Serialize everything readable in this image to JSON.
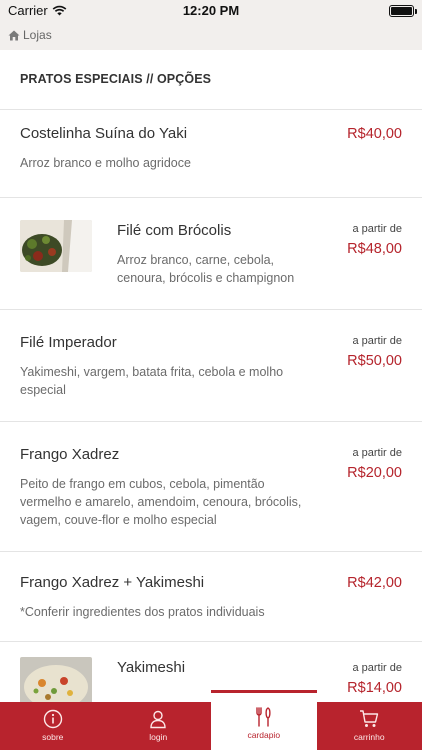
{
  "status_bar": {
    "carrier": "Carrier",
    "time": "12:20 PM",
    "battery_level": 1.0
  },
  "nav": {
    "back_label": "Lojas",
    "back_icon": "home-icon"
  },
  "section": {
    "title": "PRATOS ESPECIAIS // OPÇÕES"
  },
  "items": [
    {
      "name": "Costelinha Suína do Yaki",
      "desc": "Arroz branco e molho agridoce",
      "price_from": "",
      "price": "R$40,00",
      "has_image": false
    },
    {
      "name": "Filé com Brócolis",
      "desc": "Arroz branco, carne, cebola, cenoura, brócolis e champignon",
      "price_from": "a partir de",
      "price": "R$48,00",
      "has_image": true
    },
    {
      "name": "Filé Imperador",
      "desc": "Yakimeshi, vargem, batata frita, cebola e molho especial",
      "price_from": "a partir de",
      "price": "R$50,00",
      "has_image": false
    },
    {
      "name": "Frango Xadrez",
      "desc": "Peito de frango em cubos, cebola, pimentão vermelho e amarelo, amendoim, cenoura, brócolis, vagem, couve-flor e molho especial",
      "price_from": "a partir de",
      "price": "R$20,00",
      "has_image": false
    },
    {
      "name": "Frango Xadrez + Yakimeshi",
      "desc": "*Conferir ingredientes dos pratos individuais",
      "price_from": "",
      "price": "R$42,00",
      "has_image": false
    },
    {
      "name": "Yakimeshi",
      "desc": "",
      "price_from": "a partir de",
      "price": "R$14,00",
      "has_image": true
    }
  ],
  "tabs": [
    {
      "label": "sobre",
      "icon": "info-icon",
      "active": false
    },
    {
      "label": "login",
      "icon": "user-icon",
      "active": false
    },
    {
      "label": "cardapio",
      "icon": "cutlery-icon",
      "active": true
    },
    {
      "label": "carrinho",
      "icon": "cart-icon",
      "active": false
    }
  ],
  "colors": {
    "accent": "#b8232d",
    "price": "#b5242c",
    "header_bg": "#f2efed"
  }
}
